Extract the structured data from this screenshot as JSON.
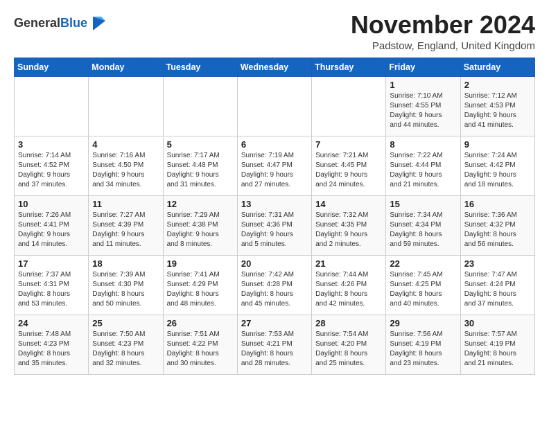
{
  "logo": {
    "general": "General",
    "blue": "Blue"
  },
  "header": {
    "month_title": "November 2024",
    "location": "Padstow, England, United Kingdom"
  },
  "weekdays": [
    "Sunday",
    "Monday",
    "Tuesday",
    "Wednesday",
    "Thursday",
    "Friday",
    "Saturday"
  ],
  "weeks": [
    [
      {
        "day": "",
        "info": ""
      },
      {
        "day": "",
        "info": ""
      },
      {
        "day": "",
        "info": ""
      },
      {
        "day": "",
        "info": ""
      },
      {
        "day": "",
        "info": ""
      },
      {
        "day": "1",
        "info": "Sunrise: 7:10 AM\nSunset: 4:55 PM\nDaylight: 9 hours\nand 44 minutes."
      },
      {
        "day": "2",
        "info": "Sunrise: 7:12 AM\nSunset: 4:53 PM\nDaylight: 9 hours\nand 41 minutes."
      }
    ],
    [
      {
        "day": "3",
        "info": "Sunrise: 7:14 AM\nSunset: 4:52 PM\nDaylight: 9 hours\nand 37 minutes."
      },
      {
        "day": "4",
        "info": "Sunrise: 7:16 AM\nSunset: 4:50 PM\nDaylight: 9 hours\nand 34 minutes."
      },
      {
        "day": "5",
        "info": "Sunrise: 7:17 AM\nSunset: 4:48 PM\nDaylight: 9 hours\nand 31 minutes."
      },
      {
        "day": "6",
        "info": "Sunrise: 7:19 AM\nSunset: 4:47 PM\nDaylight: 9 hours\nand 27 minutes."
      },
      {
        "day": "7",
        "info": "Sunrise: 7:21 AM\nSunset: 4:45 PM\nDaylight: 9 hours\nand 24 minutes."
      },
      {
        "day": "8",
        "info": "Sunrise: 7:22 AM\nSunset: 4:44 PM\nDaylight: 9 hours\nand 21 minutes."
      },
      {
        "day": "9",
        "info": "Sunrise: 7:24 AM\nSunset: 4:42 PM\nDaylight: 9 hours\nand 18 minutes."
      }
    ],
    [
      {
        "day": "10",
        "info": "Sunrise: 7:26 AM\nSunset: 4:41 PM\nDaylight: 9 hours\nand 14 minutes."
      },
      {
        "day": "11",
        "info": "Sunrise: 7:27 AM\nSunset: 4:39 PM\nDaylight: 9 hours\nand 11 minutes."
      },
      {
        "day": "12",
        "info": "Sunrise: 7:29 AM\nSunset: 4:38 PM\nDaylight: 9 hours\nand 8 minutes."
      },
      {
        "day": "13",
        "info": "Sunrise: 7:31 AM\nSunset: 4:36 PM\nDaylight: 9 hours\nand 5 minutes."
      },
      {
        "day": "14",
        "info": "Sunrise: 7:32 AM\nSunset: 4:35 PM\nDaylight: 9 hours\nand 2 minutes."
      },
      {
        "day": "15",
        "info": "Sunrise: 7:34 AM\nSunset: 4:34 PM\nDaylight: 8 hours\nand 59 minutes."
      },
      {
        "day": "16",
        "info": "Sunrise: 7:36 AM\nSunset: 4:32 PM\nDaylight: 8 hours\nand 56 minutes."
      }
    ],
    [
      {
        "day": "17",
        "info": "Sunrise: 7:37 AM\nSunset: 4:31 PM\nDaylight: 8 hours\nand 53 minutes."
      },
      {
        "day": "18",
        "info": "Sunrise: 7:39 AM\nSunset: 4:30 PM\nDaylight: 8 hours\nand 50 minutes."
      },
      {
        "day": "19",
        "info": "Sunrise: 7:41 AM\nSunset: 4:29 PM\nDaylight: 8 hours\nand 48 minutes."
      },
      {
        "day": "20",
        "info": "Sunrise: 7:42 AM\nSunset: 4:28 PM\nDaylight: 8 hours\nand 45 minutes."
      },
      {
        "day": "21",
        "info": "Sunrise: 7:44 AM\nSunset: 4:26 PM\nDaylight: 8 hours\nand 42 minutes."
      },
      {
        "day": "22",
        "info": "Sunrise: 7:45 AM\nSunset: 4:25 PM\nDaylight: 8 hours\nand 40 minutes."
      },
      {
        "day": "23",
        "info": "Sunrise: 7:47 AM\nSunset: 4:24 PM\nDaylight: 8 hours\nand 37 minutes."
      }
    ],
    [
      {
        "day": "24",
        "info": "Sunrise: 7:48 AM\nSunset: 4:23 PM\nDaylight: 8 hours\nand 35 minutes."
      },
      {
        "day": "25",
        "info": "Sunrise: 7:50 AM\nSunset: 4:23 PM\nDaylight: 8 hours\nand 32 minutes."
      },
      {
        "day": "26",
        "info": "Sunrise: 7:51 AM\nSunset: 4:22 PM\nDaylight: 8 hours\nand 30 minutes."
      },
      {
        "day": "27",
        "info": "Sunrise: 7:53 AM\nSunset: 4:21 PM\nDaylight: 8 hours\nand 28 minutes."
      },
      {
        "day": "28",
        "info": "Sunrise: 7:54 AM\nSunset: 4:20 PM\nDaylight: 8 hours\nand 25 minutes."
      },
      {
        "day": "29",
        "info": "Sunrise: 7:56 AM\nSunset: 4:19 PM\nDaylight: 8 hours\nand 23 minutes."
      },
      {
        "day": "30",
        "info": "Sunrise: 7:57 AM\nSunset: 4:19 PM\nDaylight: 8 hours\nand 21 minutes."
      }
    ]
  ]
}
